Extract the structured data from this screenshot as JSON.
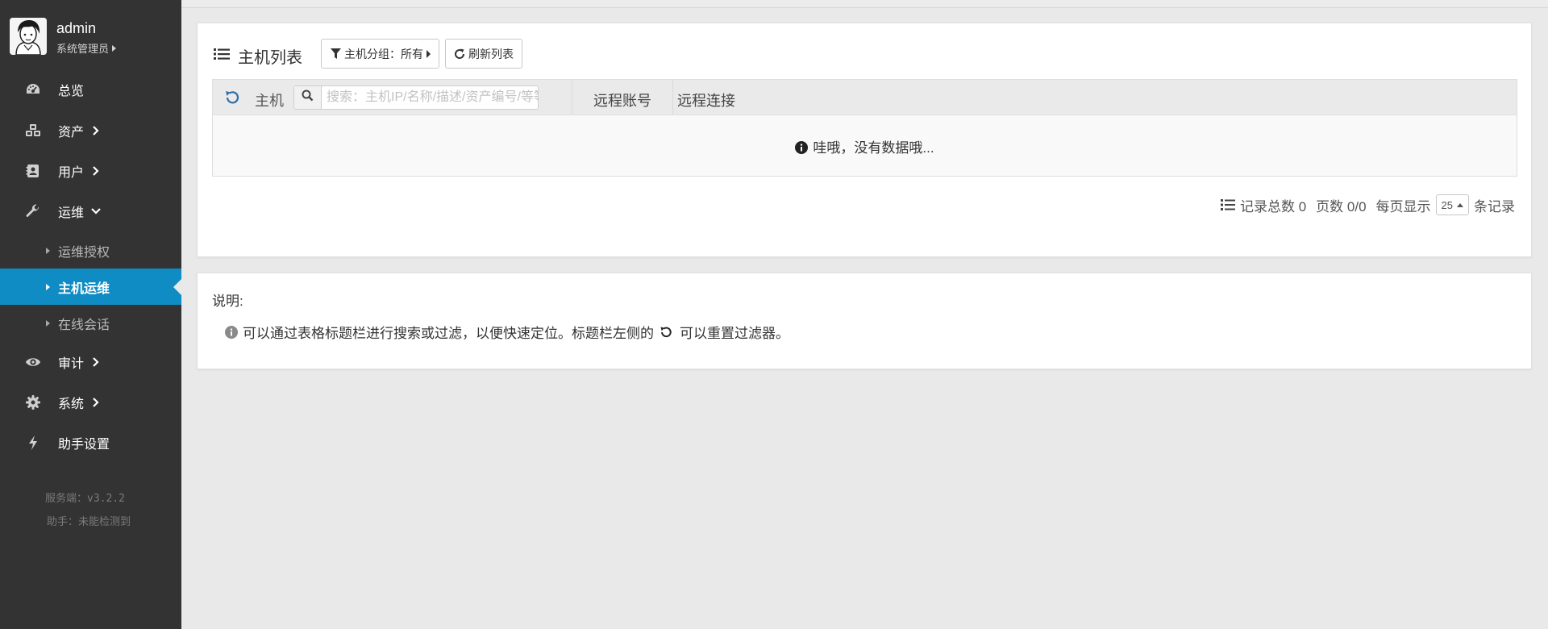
{
  "user": {
    "name": "admin",
    "role": "系统管理员"
  },
  "sidebar": {
    "items": [
      {
        "label": "总览",
        "icon": "dashboard-icon"
      },
      {
        "label": "资产",
        "icon": "cubes-icon"
      },
      {
        "label": "用户",
        "icon": "address-book-icon"
      },
      {
        "label": "运维",
        "icon": "wrench-icon"
      },
      {
        "label": "审计",
        "icon": "eye-icon"
      },
      {
        "label": "系统",
        "icon": "gear-icon"
      },
      {
        "label": "助手设置",
        "icon": "bolt-icon"
      }
    ],
    "ops_sub": [
      {
        "label": "运维授权",
        "active": false
      },
      {
        "label": "主机运维",
        "active": true
      },
      {
        "label": "在线会话",
        "active": false
      }
    ],
    "footer": {
      "server": "服务端：v3.2.2",
      "assistant": "助手：未能检测到"
    },
    "active_color": "#0f8cc4",
    "background": "#333333"
  },
  "main": {
    "title": "主机列表",
    "group_button": "主机分组：所有",
    "refresh_button": "刷新列表",
    "table": {
      "col_host": "主机",
      "search_placeholder": "搜索：主机IP/名称/描述/资产编号/等等...",
      "col_account": "远程账号",
      "col_connect": "远程连接",
      "empty": "哇哦，没有数据哦..."
    },
    "pager": {
      "total": "记录总数 0",
      "pages": "页数 0/0",
      "per_page_label": "每页显示",
      "per_page_value": "25",
      "suffix": "条记录"
    }
  },
  "notes": {
    "title": "说明:",
    "line_before": "可以通过表格标题栏进行搜索或过滤，以便快速定位。标题栏左侧的",
    "line_after": "可以重置过滤器。"
  }
}
